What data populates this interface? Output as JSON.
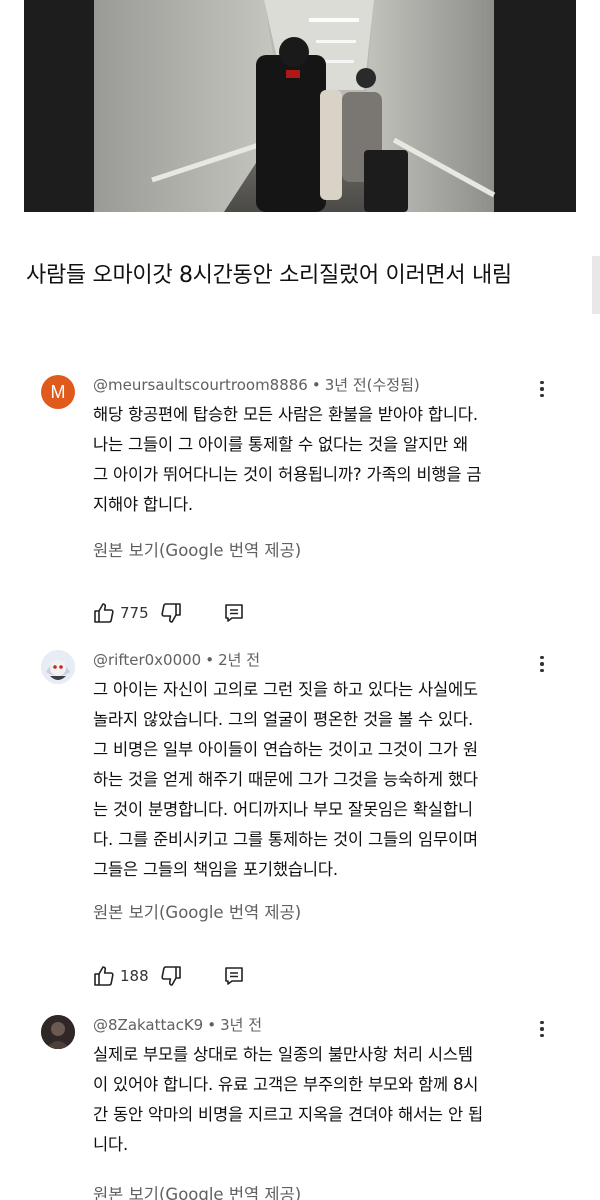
{
  "video": {
    "alt": "airplane jet bridge scene"
  },
  "caption": "사람들 오마이갓 8시간동안 소리질렀어 이러면서 내림",
  "translate_label": "원본 보기(Google 번역 제공)",
  "comments": [
    {
      "avatar_letter": "M",
      "avatar_color": "#e05a1c",
      "username": "@meursaultscourtroom8886",
      "time": "3년 전(수정됨)",
      "lines": [
        "해당 항공편에 탑승한 모든 사람은 환불을 받아야 합니다.",
        "나는 그들이 그 아이를 통제할 수 없다는 것을 알지만 왜",
        "그 아이가 뛰어다니는 것이 허용됩니까? 가족의 비행을 금",
        "지해야 합니다."
      ],
      "likes": "775"
    },
    {
      "avatar_letter": "",
      "username": "@rifter0x0000",
      "time": "2년 전",
      "lines": [
        "그 아이는 자신이 고의로 그런 짓을 하고 있다는 사실에도",
        "놀라지 않았습니다. 그의 얼굴이 평온한 것을 볼 수 있다.",
        "그 비명은 일부 아이들이 연습하는 것이고 그것이 그가 원",
        "하는 것을 얻게 해주기 때문에 그가 그것을 능숙하게 했다",
        "는 것이 분명합니다. 어디까지나 부모 잘못임은 확실합니",
        "다. 그를 준비시키고 그를 통제하는 것이 그들의 임무이며",
        "그들은 그들의 책임을 포기했습니다."
      ],
      "likes": "188"
    },
    {
      "avatar_letter": "",
      "username": "@8ZakattacK9",
      "time": "3년 전",
      "lines": [
        "실제로 부모를 상대로 하는 일종의 불만사항 처리 시스템",
        "이 있어야 합니다. 유료 고객은 부주의한 부모와 함께 8시",
        "간 동안 악마의 비명을 지르고 지옥을 견뎌야 해서는 안 됩",
        "니다."
      ]
    }
  ]
}
